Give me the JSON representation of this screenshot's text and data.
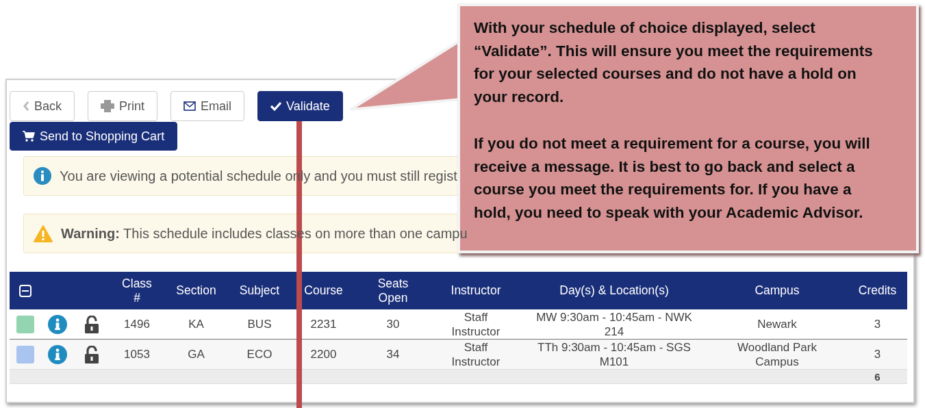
{
  "toolbar": [
    {
      "kind": "back",
      "label": "Back",
      "primary": false
    },
    {
      "kind": "print",
      "label": "Print",
      "primary": false
    },
    {
      "kind": "email",
      "label": "Email",
      "primary": false
    },
    {
      "kind": "validate",
      "label": "Validate",
      "primary": true
    },
    {
      "kind": "cart",
      "label": "Send to Shopping Cart",
      "primary": true
    }
  ],
  "alerts": [
    {
      "kind": "info",
      "text": "You are viewing a potential schedule only and you must still regist"
    },
    {
      "kind": "warning",
      "text": "**Warning:** This schedule includes classes on more than one campu"
    }
  ],
  "table": {
    "columns": [
      "Class #",
      "Section",
      "Subject",
      "Course",
      "Seats Open",
      "Instructor",
      "Day(s) & Location(s)",
      "Campus",
      "Credits"
    ],
    "rows": [
      {
        "color": "#93d5b0",
        "cells": [
          "1496",
          "KA",
          "BUS",
          "2231",
          "30",
          "Staff Instructor",
          "MW 9:30am - 10:45am - NWK 214",
          "Newark",
          "3"
        ]
      },
      {
        "color": "#a9c4ef",
        "cells": [
          "1053",
          "GA",
          "ECO",
          "2200",
          "34",
          "Staff Instructor",
          "TTh 9:30am - 10:45am - SGS M101",
          "Woodland Park Campus",
          "3"
        ]
      }
    ],
    "total_credits": "6"
  },
  "callout": {
    "paragraphs": [
      "With your schedule of choice displayed, select “Validate”.  This will ensure you meet the requirements for your selected courses and do not have a hold on your record.",
      "If you do not meet a requirement for a course, you will receive a message.  It is best to go back and select a course you meet the requirements for.  If you have a hold, you need to speak with your Academic Advisor."
    ]
  }
}
